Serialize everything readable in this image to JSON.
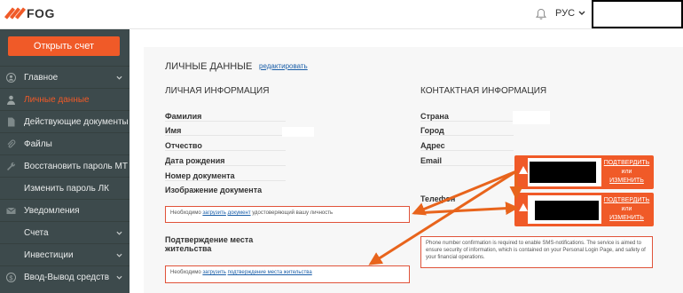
{
  "header": {
    "logo_text": "FOG",
    "language": "РУС"
  },
  "sidebar": {
    "cta_label": "Открыть счет",
    "items": [
      {
        "label": "Главное",
        "icon": "circle-user-icon",
        "chevron": true,
        "active": false
      },
      {
        "label": "Личные данные",
        "icon": "person-icon",
        "chevron": false,
        "active": true
      },
      {
        "label": "Действующие документы",
        "icon": "document-icon",
        "chevron": false,
        "active": false
      },
      {
        "label": "Файлы",
        "icon": "paperclip-icon",
        "chevron": false,
        "active": false
      },
      {
        "label": "Восстановить пароль МТ",
        "icon": "wrench-icon",
        "chevron": false,
        "active": false
      },
      {
        "label": "Изменить пароль ЛК",
        "icon": "",
        "chevron": false,
        "active": false
      },
      {
        "label": "Уведомления",
        "icon": "envelope-icon",
        "chevron": false,
        "active": false
      },
      {
        "label": "Счета",
        "icon": "",
        "chevron": true,
        "active": false
      },
      {
        "label": "Инвестиции",
        "icon": "",
        "chevron": true,
        "active": false
      },
      {
        "label": "Ввод-Вывод средств",
        "icon": "dollar-icon",
        "chevron": true,
        "active": false
      }
    ]
  },
  "main": {
    "title": "ЛИЧНЫЕ ДАННЫЕ",
    "edit_link": "редактировать",
    "personal": {
      "heading": "ЛИЧНАЯ ИНФОРМАЦИЯ",
      "fields": [
        "Фамилия",
        "Имя",
        "Отчество",
        "Дата рождения",
        "Номер документа",
        "Изображение документа"
      ],
      "notice_prefix": "Необходимо ",
      "notice_link1": "загрузить",
      "notice_link2": "документ",
      "notice_suffix": " удостоверяющий вашу личность"
    },
    "residence": {
      "heading_line1": "Подтверждение места",
      "heading_line2": "жительства",
      "notice_prefix": "Необходимо ",
      "notice_link1": "загрузить",
      "notice_link2": "подтверждение места жительства"
    },
    "contact": {
      "heading": "КОНТАКТНАЯ ИНФОРМАЦИЯ",
      "fields": [
        "Страна",
        "Город",
        "Адрес",
        "Email",
        "Телефон"
      ],
      "confirm_label": "ПОДТВЕРДИТЬ",
      "or_label": "или",
      "change_label": "ИЗМЕНИТЬ",
      "sms_notice": "Phone number confirmation is required to enable SMS-notifications. The service is aimed to ensure security of information, which is contained on your Personal Login Page, and safety of your financial operations."
    },
    "annotation_color": "#e8641c"
  }
}
